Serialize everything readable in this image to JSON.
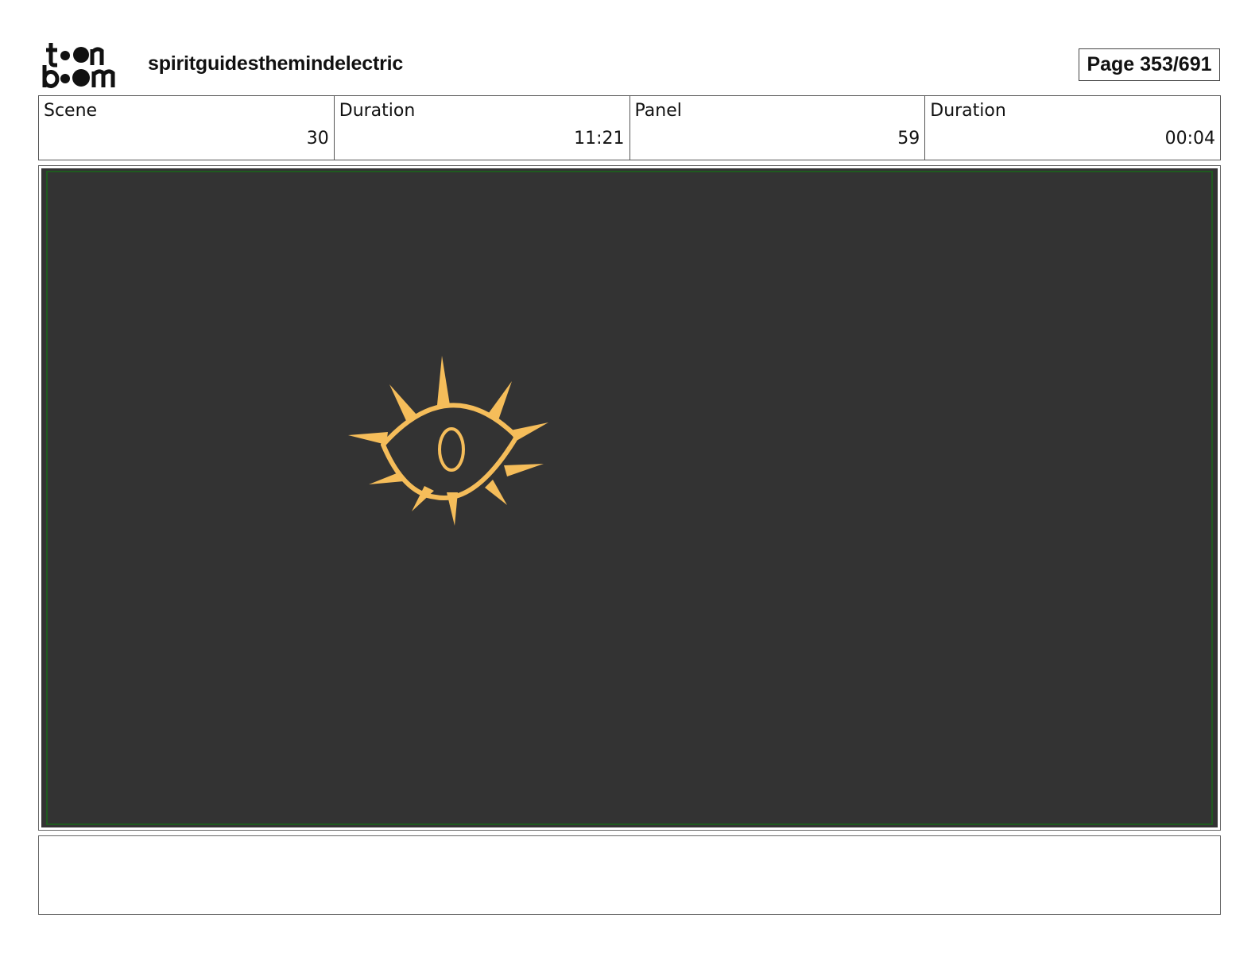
{
  "header": {
    "logo": {
      "text_line1": "toon",
      "text_line2": "boom",
      "icon": "toon-boom-logo"
    },
    "project_title": "spiritguidesthemindelectric",
    "page_label": "Page 353/691"
  },
  "info": {
    "scene": {
      "label": "Scene",
      "value": "30"
    },
    "scene_duration": {
      "label": "Duration",
      "value": "11:21"
    },
    "panel": {
      "label": "Panel",
      "value": "59"
    },
    "panel_duration": {
      "label": "Duration",
      "value": "00:04"
    }
  },
  "panel_image": {
    "background_color": "#333333",
    "safe_frame_color": "#1f5a1f",
    "drawing": "eye-with-rays-icon",
    "drawing_color": "#f5bd5a"
  },
  "notes": {
    "text": ""
  }
}
